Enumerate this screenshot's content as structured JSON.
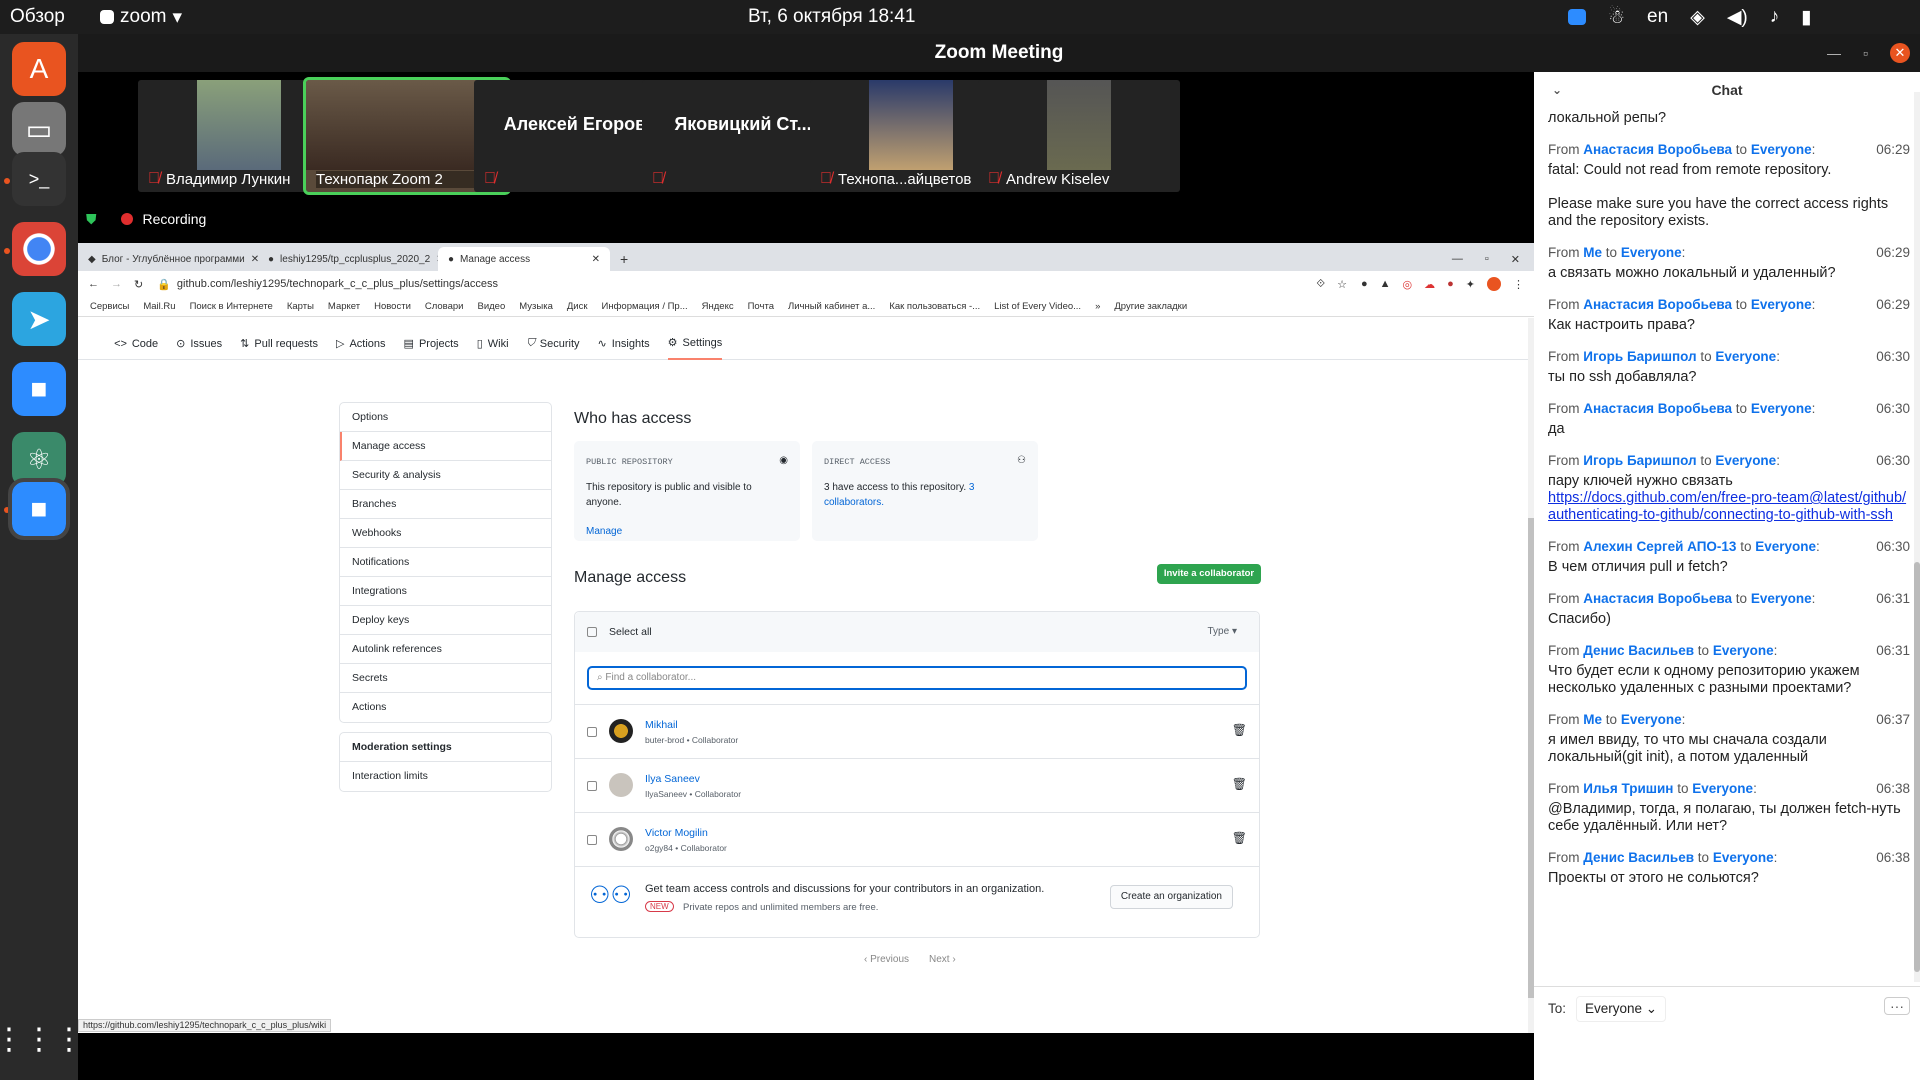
{
  "topbar": {
    "overview": "Обзор",
    "app": "zoom",
    "datetime": "Вт, 6 октября  18:41",
    "lang": "en"
  },
  "zoom": {
    "title": "Zoom Meeting",
    "recording": "Recording",
    "participants": [
      {
        "name": "Владимир Лункин",
        "video": true
      },
      {
        "name": "Технопарк Zoom 2",
        "video": true,
        "active": true
      },
      {
        "name": "Алексей Егоров",
        "video": false
      },
      {
        "name": "Яковицкий Ст...",
        "video": false
      },
      {
        "name": "Технопа...айцветов",
        "video": true
      },
      {
        "name": "Andrew Kiselev",
        "video": true
      }
    ]
  },
  "browser": {
    "tabs": [
      "Блог - Углублённое программи",
      "leshiy1295/tp_ccplusplus_2020_2",
      "Manage access"
    ],
    "url": "github.com/leshiy1295/technopark_c_c_plus_plus/settings/access",
    "bookmarks": [
      "Сервисы",
      "Mail.Ru",
      "Поиск в Интернете",
      "Карты",
      "Маркет",
      "Новости",
      "Словари",
      "Видео",
      "Музыка",
      "Диск",
      "Информация / Пр...",
      "Яндекс",
      "Почта",
      "Личный кабинет а...",
      "Как пользоваться -...",
      "List of Every Video..."
    ],
    "other_bookmarks": "Другие закладки",
    "status_url": "https://github.com/leshiy1295/technopark_c_c_plus_plus/wiki"
  },
  "github": {
    "repo_nav": [
      "Code",
      "Issues",
      "Pull requests",
      "Actions",
      "Projects",
      "Wiki",
      "Security",
      "Insights",
      "Settings"
    ],
    "menu": [
      "Options",
      "Manage access",
      "Security & analysis",
      "Branches",
      "Webhooks",
      "Notifications",
      "Integrations",
      "Deploy keys",
      "Autolink references",
      "Secrets",
      "Actions"
    ],
    "menu2": [
      "Moderation settings",
      "Interaction limits"
    ],
    "who_title": "Who has access",
    "public_card": {
      "heading": "PUBLIC REPOSITORY",
      "text": "This repository is public and visible to anyone.",
      "link": "Manage"
    },
    "direct_card": {
      "heading": "DIRECT ACCESS",
      "text": "3 have access to this repository.",
      "link": "3 collaborators."
    },
    "manage_title": "Manage access",
    "invite_button": "Invite a collaborator",
    "select_all": "Select all",
    "type_filter": "Type",
    "search_placeholder": "Find a collaborator...",
    "collaborators": [
      {
        "name": "Mikhail",
        "sub": "buter-brod • Collaborator"
      },
      {
        "name": "Ilya Saneev",
        "sub": "IlyaSaneev • Collaborator"
      },
      {
        "name": "Victor Mogilin",
        "sub": "o2gy84 • Collaborator"
      }
    ],
    "org_promo": "Get team access controls and discussions for your contributors in an organization.",
    "new_badge": "NEW",
    "org_sub": "Private repos and unlimited members are free.",
    "create_org": "Create an organization",
    "prev": "Previous",
    "next": "Next"
  },
  "chat": {
    "title": "Chat",
    "first_line": "локальной репы?",
    "messages": [
      {
        "from": "Анастасия Воробьева",
        "to": "Everyone",
        "time": "06:29",
        "text": "fatal: Could not read from remote repository.\n\nPlease make sure you have the correct access rights\nand the repository exists."
      },
      {
        "from": "Me",
        "to": "Everyone",
        "time": "06:29",
        "text": "а связать можно локальный и удаленный?"
      },
      {
        "from": "Анастасия Воробьева",
        "to": "Everyone",
        "time": "06:29",
        "text": "Как настроить права?"
      },
      {
        "from": "Игорь Баришпол",
        "to": "Everyone",
        "time": "06:30",
        "text": "ты по ssh добавляла?"
      },
      {
        "from": "Анастасия Воробьева",
        "to": "Everyone",
        "time": "06:30",
        "text": "да"
      },
      {
        "from": "Игорь Баришпол",
        "to": "Everyone",
        "time": "06:30",
        "text": "пару ключей нужно связать",
        "link": "https://docs.github.com/en/free-pro-team@latest/github/authenticating-to-github/connecting-to-github-with-ssh"
      },
      {
        "from": "Алехин Сергей АПО-13",
        "to": "Everyone",
        "time": "06:30",
        "text": "В чем отличия pull и fetch?"
      },
      {
        "from": "Анастасия Воробьева",
        "to": "Everyone",
        "time": "06:31",
        "text": "Спасибо)"
      },
      {
        "from": "Денис Васильев",
        "to": "Everyone",
        "time": "06:31",
        "text": "Что будет если к одному репозиторию укажем несколько удаленных с разными проектами?"
      },
      {
        "from": "Me",
        "to": "Everyone",
        "time": "06:37",
        "text": "я имел ввиду, то что мы сначала создали локальный(git init), а потом удаленный"
      },
      {
        "from": "Илья Тришин",
        "to": "Everyone",
        "time": "06:38",
        "text": "@Владимир, тогда, я полагаю, ты должен fetch-нуть себе удалённый. Или нет?"
      },
      {
        "from": "Денис Васильев",
        "to": "Everyone",
        "time": "06:38",
        "text": "Проекты от этого не сольются?"
      }
    ],
    "from_word": "From",
    "to_word": "to",
    "to_label": "To:",
    "to_value": "Everyone"
  }
}
